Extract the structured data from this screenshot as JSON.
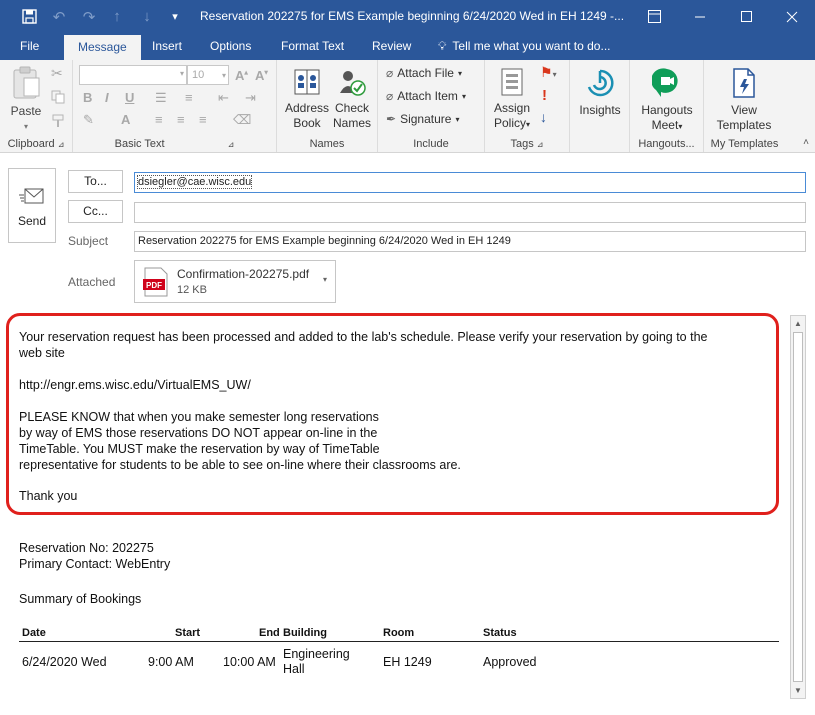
{
  "window": {
    "title": "Reservation 202275 for EMS Example beginning 6/24/2020 Wed in EH 1249 -...",
    "icons": [
      "save-icon",
      "undo-icon",
      "redo-icon",
      "up-arrow-icon",
      "down-arrow-icon",
      "customize-icon",
      "ribbon-display-icon",
      "minimize-icon",
      "maximize-icon",
      "close-icon"
    ]
  },
  "tabs": {
    "file": "File",
    "message": "Message",
    "insert": "Insert",
    "options": "Options",
    "format_text": "Format Text",
    "review": "Review",
    "tell_me": "Tell me what you want to do..."
  },
  "ribbon": {
    "clipboard": {
      "paste": "Paste",
      "label": "Clipboard"
    },
    "basic_text": {
      "font_size": "10",
      "bold": "B",
      "italic": "I",
      "underline": "U",
      "label": "Basic Text"
    },
    "names": {
      "address_book_1": "Address",
      "address_book_2": "Book",
      "check_names_1": "Check",
      "check_names_2": "Names",
      "label": "Names"
    },
    "include": {
      "attach_file": "Attach File",
      "attach_item": "Attach Item",
      "signature": "Signature",
      "label": "Include"
    },
    "tags": {
      "assign_policy_1": "Assign",
      "assign_policy_2": "Policy",
      "label": "Tags"
    },
    "insights": {
      "label": "Insights"
    },
    "hangouts": {
      "meet_1": "Hangouts",
      "meet_2": "Meet",
      "label": "Hangouts..."
    },
    "my_templates": {
      "view_1": "View",
      "view_2": "Templates",
      "label": "My Templates"
    }
  },
  "compose": {
    "send_label": "Send",
    "to_button": "To...",
    "cc_button": "Cc...",
    "to_value": "dsiegler@cae.wisc.edu",
    "cc_value": "",
    "subject_label": "Subject",
    "subject_value": "Reservation 202275 for EMS Example beginning 6/24/2020 Wed in EH 1249",
    "attached_label": "Attached",
    "attachment": {
      "name": "Confirmation-202275.pdf",
      "size": "12 KB",
      "type": "PDF"
    }
  },
  "body": {
    "p1_line1": "Your reservation request has been processed and added to the lab's schedule. Please verify your reservation by going to the",
    "p1_line2": "web site",
    "url": "http://engr.ems.wisc.edu/VirtualEMS_UW/",
    "p2_line1": "PLEASE KNOW that when you make semester long reservations",
    "p2_line2": "by way of EMS those reservations DO NOT appear on-line in the",
    "p2_line3": "TimeTable. You MUST make the reservation by way of TimeTable",
    "p2_line4": "representative for students to be able to see on-line where their classrooms are.",
    "thanks": "Thank you",
    "reservation_no": "Reservation No: 202275",
    "primary_contact": "Primary Contact: WebEntry",
    "summary": "Summary of Bookings",
    "table": {
      "headers": [
        "Date",
        "Start",
        "End",
        "Building",
        "Room",
        "Status"
      ],
      "row": {
        "date": "6/24/2020 Wed",
        "start": "9:00 AM",
        "end": "10:00 AM",
        "building_1": "Engineering",
        "building_2": "Hall",
        "room": "EH 1249",
        "status": "Approved"
      }
    }
  },
  "colors": {
    "title_bar": "#2b579a",
    "highlight": "#e0201c",
    "pdf": "#d0021b"
  }
}
